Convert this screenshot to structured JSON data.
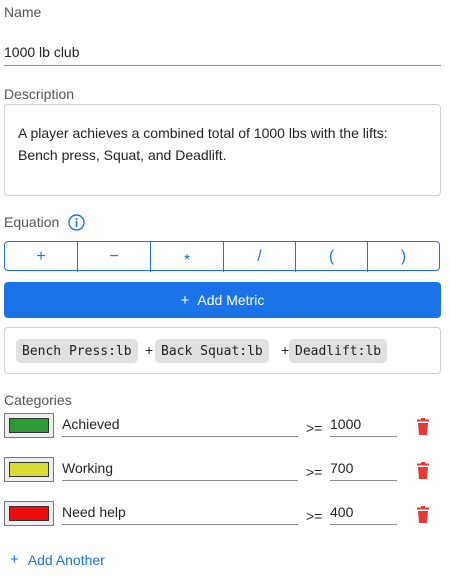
{
  "name": {
    "label": "Name",
    "value": "1000 lb club"
  },
  "description": {
    "label": "Description",
    "value": "A player achieves a combined total of 1000 lbs with the lifts: Bench press, Squat, and Deadlift."
  },
  "equation": {
    "label": "Equation",
    "info_icon": "info-icon",
    "operators": [
      "+",
      "−",
      "*",
      "/",
      "(",
      ")"
    ],
    "add_metric_label": "Add Metric",
    "add_metric_icon": "+",
    "terms": [
      {
        "op": "",
        "metric": "Bench Press:lb"
      },
      {
        "op": "+",
        "metric": "Back Squat:lb"
      },
      {
        "op": "+",
        "metric": "Deadlift:lb"
      }
    ]
  },
  "categories": {
    "label": "Categories",
    "items": [
      {
        "name": "Achieved",
        "operator": ">=",
        "threshold": "1000",
        "color": "#2e9a36"
      },
      {
        "name": "Working",
        "operator": ">=",
        "threshold": "700",
        "color": "#d8dd35"
      },
      {
        "name": "Need help",
        "operator": ">=",
        "threshold": "400",
        "color": "#f20d0d"
      }
    ],
    "delete_icon": "trash-icon",
    "add_another_label": "Add Another",
    "add_another_icon": "+"
  },
  "colors": {
    "accent": "#1a73e8",
    "delete": "#e53935"
  }
}
